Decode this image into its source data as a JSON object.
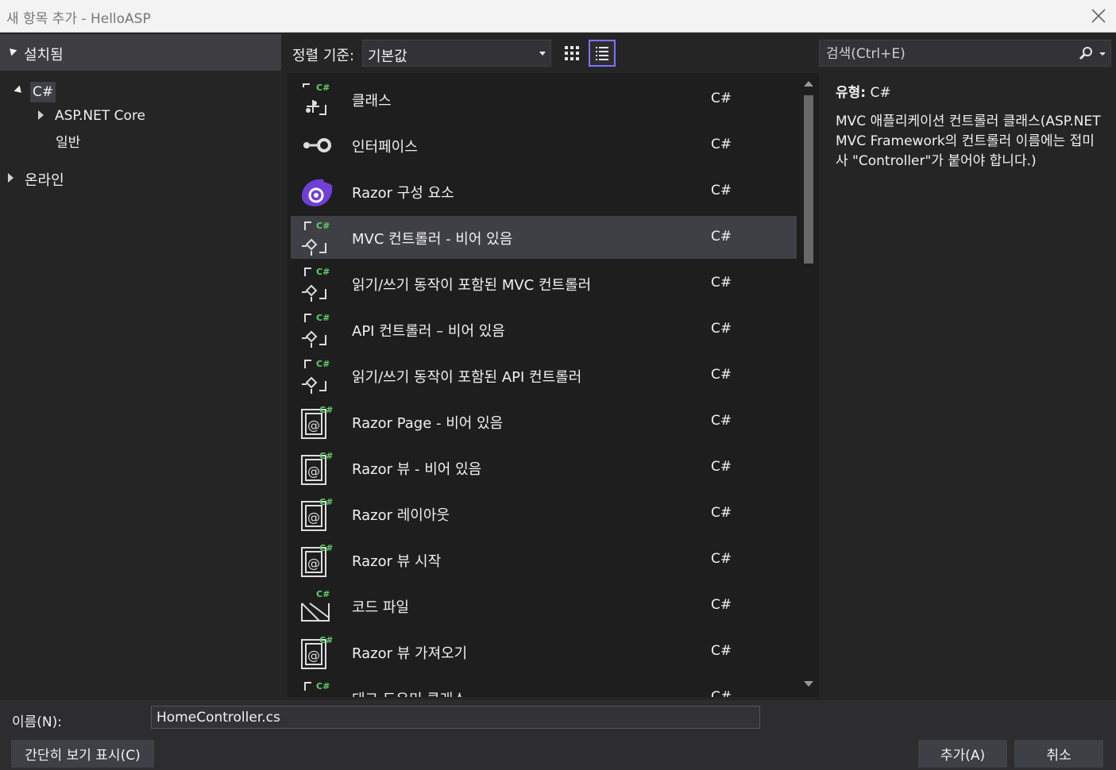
{
  "window": {
    "title": "새 항목 추가 - HelloASP",
    "close_icon": "close-icon"
  },
  "left_panel": {
    "header": "설치됨",
    "tree": [
      {
        "label": "C#",
        "expanded": true
      },
      {
        "label": "ASP.NET Core",
        "expanded": false
      },
      {
        "label": "일반"
      },
      {
        "label": "온라인",
        "expanded": false
      }
    ]
  },
  "toolbar": {
    "sort_label": "정렬 기준:",
    "sort_value": "기본값",
    "view_grid_icon": "grid-view-icon",
    "view_list_icon": "list-view-icon"
  },
  "search": {
    "placeholder": "검색(Ctrl+E)",
    "icon": "search-icon"
  },
  "items": [
    {
      "name": "클래스",
      "lang": "C#",
      "icon": "class-icon"
    },
    {
      "name": "인터페이스",
      "lang": "C#",
      "icon": "interface-icon"
    },
    {
      "name": "Razor 구성 요소",
      "lang": "C#",
      "icon": "razor-component-icon"
    },
    {
      "name": "MVC 컨트롤러 - 비어 있음",
      "lang": "C#",
      "icon": "controller-icon",
      "selected": true
    },
    {
      "name": "읽기/쓰기 동작이 포함된 MVC 컨트롤러",
      "lang": "C#",
      "icon": "controller-icon"
    },
    {
      "name": "API 컨트롤러 – 비어 있음",
      "lang": "C#",
      "icon": "controller-icon"
    },
    {
      "name": "읽기/쓰기 동작이 포함된 API 컨트롤러",
      "lang": "C#",
      "icon": "controller-icon"
    },
    {
      "name": "Razor Page - 비어 있음",
      "lang": "C#",
      "icon": "razor-page-icon"
    },
    {
      "name": "Razor 뷰 - 비어 있음",
      "lang": "C#",
      "icon": "razor-page-icon"
    },
    {
      "name": "Razor 레이아웃",
      "lang": "C#",
      "icon": "razor-page-icon"
    },
    {
      "name": "Razor 뷰 시작",
      "lang": "C#",
      "icon": "razor-page-icon"
    },
    {
      "name": "코드 파일",
      "lang": "C#",
      "icon": "code-file-icon"
    },
    {
      "name": "Razor 뷰 가져오기",
      "lang": "C#",
      "icon": "razor-page-icon"
    },
    {
      "name": "태그 도우미 클래스",
      "lang": "C#",
      "icon": "controller-icon"
    }
  ],
  "detail": {
    "type_label": "유형:",
    "type_value": "C#",
    "description": "MVC 애플리케이션 컨트롤러 클래스(ASP.NET MVC Framework의 컨트롤러 이름에는 접미사 \"Controller\"가 붙어야 합니다.)"
  },
  "footer": {
    "name_label": "이름(N):",
    "name_value": "HomeController.cs",
    "compact_view_button": "간단히 보기 표시(C)",
    "add_button": "추가(A)",
    "cancel_button": "취소"
  },
  "colors": {
    "accent": "#7b74ff",
    "csharp_badge": "#5fd068",
    "razor_purple": "#6f3fd8",
    "selected_row": "#3f3f46"
  }
}
